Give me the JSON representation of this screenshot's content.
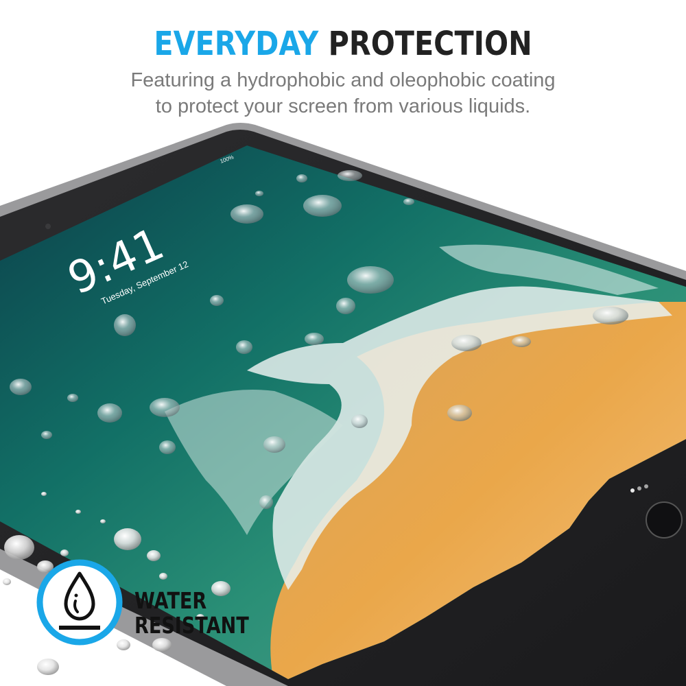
{
  "header": {
    "title_highlight": "EVERYDAY",
    "title_rest": "PROTECTION",
    "subtitle_line1": "Featuring a hydrophobic and oleophobic coating",
    "subtitle_line2": "to protect your screen from various liquids."
  },
  "lockscreen": {
    "time": "9:41",
    "date": "Tuesday, September 12",
    "battery": "100%"
  },
  "badge": {
    "line1": "WATER",
    "line2": "RESISTANT",
    "icon": "water-drop-icon"
  },
  "colors": {
    "accent": "#1aa7e8",
    "title_dark": "#222222",
    "subtitle_gray": "#7a7a7a",
    "ocean": "#0e5a52",
    "sand": "#e8a24d"
  }
}
